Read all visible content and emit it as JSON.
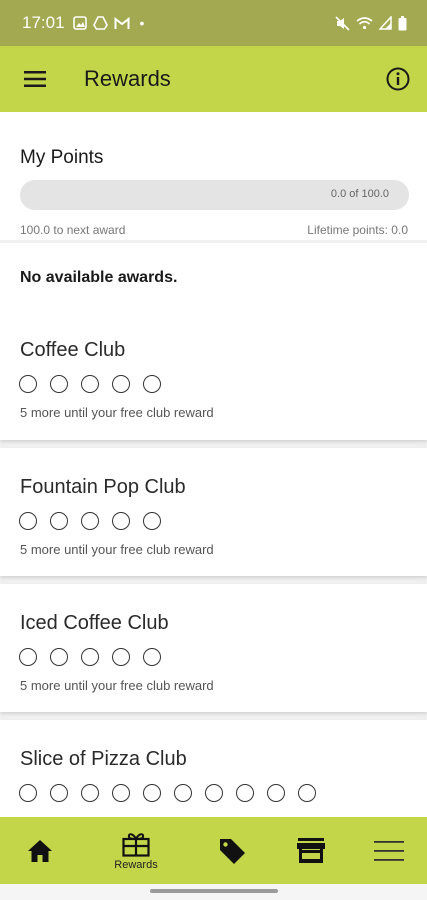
{
  "status_bar": {
    "time": "17:01",
    "left_icons": [
      "image-icon",
      "drive-icon",
      "gmail-icon",
      "dot-icon"
    ],
    "right_icons": [
      "mute-icon",
      "wifi-icon",
      "signal-icon",
      "battery-icon"
    ]
  },
  "app_bar": {
    "title": "Rewards",
    "menu_icon": "hamburger-menu-icon",
    "info_icon": "info-icon"
  },
  "points": {
    "heading": "My Points",
    "progress_text": "0.0 of 100.0",
    "progress_fraction": 0.0,
    "next_award_text": "100.0 to next award",
    "lifetime_text": "Lifetime points: 0.0"
  },
  "awards": {
    "empty_text": "No available awards."
  },
  "clubs": [
    {
      "name": "Coffee Club",
      "total": 5,
      "filled": 0,
      "remaining_text": "5 more until your free club reward"
    },
    {
      "name": "Fountain Pop Club",
      "total": 5,
      "filled": 0,
      "remaining_text": "5 more until your free club reward"
    },
    {
      "name": "Iced Coffee Club",
      "total": 5,
      "filled": 0,
      "remaining_text": "5 more until your free club reward"
    },
    {
      "name": "Slice of Pizza Club",
      "total": 10,
      "filled": 0,
      "remaining_text": ""
    }
  ],
  "bottom_nav": {
    "items": [
      {
        "icon": "home-icon",
        "label": ""
      },
      {
        "icon": "gift-icon",
        "label": "Rewards"
      },
      {
        "icon": "tag-icon",
        "label": ""
      },
      {
        "icon": "store-icon",
        "label": ""
      },
      {
        "icon": "menu-lines-icon",
        "label": ""
      }
    ]
  },
  "colors": {
    "status_bar": "#a3a950",
    "accent": "#c3d649",
    "background": "#f0f0f0",
    "card": "#ffffff"
  }
}
